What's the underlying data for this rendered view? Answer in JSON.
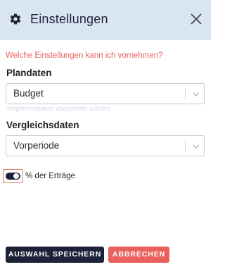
{
  "dialog": {
    "title": "Einstellungen",
    "help_link": "Welche Einstellungen kann ich vornehmen?",
    "plandaten": {
      "label": "Plandaten",
      "selected": "Budget",
      "ghost_text": "Vergleichsdaten Vorperiode wählen"
    },
    "vergleichsdaten": {
      "label": "Vergleichsdaten",
      "selected": "Vorperiode"
    },
    "toggle": {
      "label": "% der Erträge",
      "checked": true
    },
    "buttons": {
      "save": "AUSWAHL SPEICHERN",
      "cancel": "ABBRECHEN"
    }
  },
  "icons": {
    "header": "gear-icon",
    "close": "close-icon",
    "dropdown": "chevron-down-icon"
  },
  "colors": {
    "header_bg": "#d9e6f2",
    "navy": "#1d2238",
    "accent_red": "#e8615c"
  }
}
